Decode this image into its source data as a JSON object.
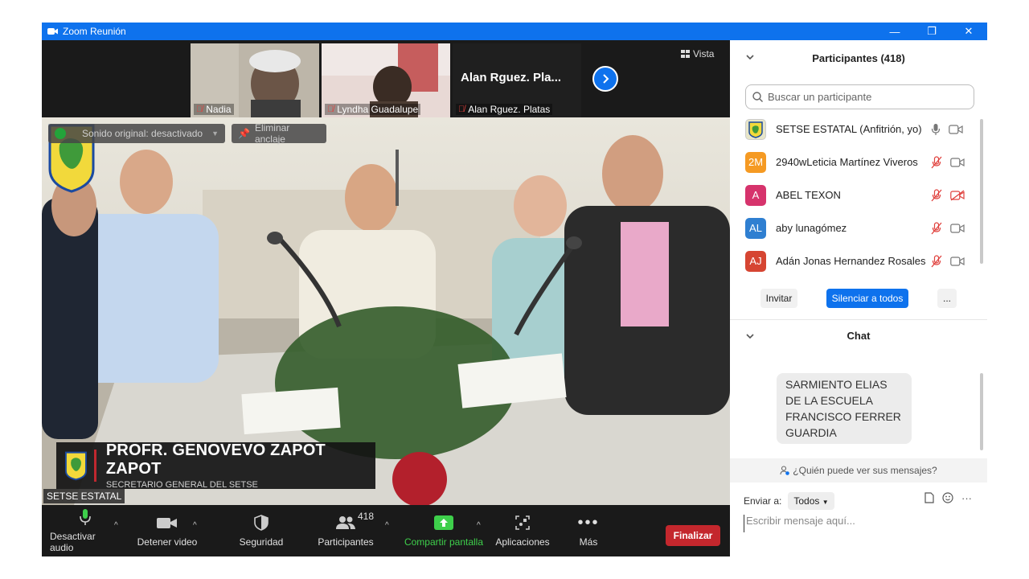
{
  "window": {
    "title": "Zoom Reunión",
    "controls": {
      "minimize": "—",
      "restore": "❐",
      "close": "✕"
    }
  },
  "thumbnails": [
    {
      "name": "Nadia",
      "mic": "muted"
    },
    {
      "name": "Lyndha Guadalupe",
      "mic": "muted"
    },
    {
      "name": "Alan  Rguez. Platas",
      "display_name": "Alan  Rguez. Pla...",
      "mic": "muted"
    }
  ],
  "view_button": "Vista",
  "main_video": {
    "original_sound": "Sonido original: desactivado",
    "unpin": "Eliminar anclaje",
    "speaker_name": "PROFR. GENOVEVO ZAPOT ZAPOT",
    "speaker_role": "SECRETARIO GENERAL DEL SETSE",
    "logo_text": "SETSE",
    "camera_label": "SETSE ESTATAL"
  },
  "toolbar": {
    "mute": "Desactivar audio",
    "video": "Detener video",
    "security": "Seguridad",
    "participants": "Participantes",
    "participants_count": "418",
    "share": "Compartir pantalla",
    "apps": "Aplicaciones",
    "more": "Más",
    "end": "Finalizar"
  },
  "participants_panel": {
    "title": "Participantes (418)",
    "search_placeholder": "Buscar un participante",
    "items": [
      {
        "initials": "",
        "name": "SETSE ESTATAL (Anfitrión, yo)",
        "color": "#e8e6c8",
        "mic": "on",
        "video": "on"
      },
      {
        "initials": "2M",
        "name": "2940wLeticia Martínez Viveros",
        "color": "#f59a23",
        "mic": "muted",
        "video": "on"
      },
      {
        "initials": "A",
        "name": "ABEL TEXON",
        "color": "#d6336c",
        "mic": "muted",
        "video": "off"
      },
      {
        "initials": "AL",
        "name": "aby lunagómez",
        "color": "#2f7fd1",
        "mic": "muted",
        "video": "on"
      },
      {
        "initials": "AJ",
        "name": "Adán Jonas Hernandez Rosales",
        "color": "#d64532",
        "mic": "muted",
        "video": "on"
      }
    ],
    "invite": "Invitar",
    "mute_all": "Silenciar a todos",
    "more": "..."
  },
  "chat": {
    "title": "Chat",
    "message": "SARMIENTO ELIAS DE LA ESCUELA FRANCISCO FERRER GUARDIA",
    "who_can_see": "¿Quién puede ver sus mensajes?",
    "send_to_label": "Enviar a:",
    "send_to_value": "Todos",
    "input_placeholder": "Escribir mensaje aquí..."
  },
  "colors": {
    "zoom_blue": "#0e72ed",
    "end_red": "#c4272d",
    "mute_red": "#e0413d",
    "share_green": "#3ecf4b"
  }
}
